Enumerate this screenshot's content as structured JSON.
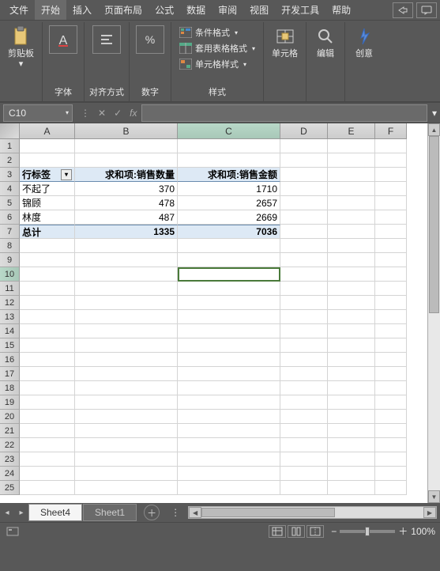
{
  "menu": {
    "items": [
      "文件",
      "开始",
      "插入",
      "页面布局",
      "公式",
      "数据",
      "审阅",
      "视图",
      "开发工具",
      "帮助"
    ],
    "active": 1
  },
  "ribbon": {
    "clipboard": {
      "label": "剪贴板",
      "dd": "▾"
    },
    "font": {
      "label": "字体"
    },
    "align": {
      "label": "对齐方式"
    },
    "number": {
      "label": "数字"
    },
    "styles": {
      "label": "样式",
      "cond": "条件格式",
      "cond_dd": "▾",
      "tbl": "套用表格格式",
      "tbl_dd": "▾",
      "cell": "单元格样式",
      "cell_dd": "▾"
    },
    "cells": {
      "label": "单元格"
    },
    "editing": {
      "label": "编辑"
    },
    "ideas": {
      "label": "创意"
    }
  },
  "namebox": {
    "value": "C10",
    "dd": "▾",
    "fx": "fx",
    "dots": "⋮"
  },
  "grid": {
    "cols": [
      {
        "name": "A",
        "w": 70
      },
      {
        "name": "B",
        "w": 130
      },
      {
        "name": "C",
        "w": 130,
        "sel": true
      },
      {
        "name": "D",
        "w": 60
      },
      {
        "name": "E",
        "w": 60
      },
      {
        "name": "F",
        "w": 40
      }
    ],
    "rowcount": 25,
    "selrow": 10,
    "selcell": {
      "r": 10,
      "c": 3
    },
    "hdr_row": 3,
    "hdr": [
      "行标签",
      "求和项:销售数量",
      "求和项:销售金额"
    ],
    "data": [
      {
        "r": 4,
        "a": "不起了",
        "b": "370",
        "c": "1710"
      },
      {
        "r": 5,
        "a": "锦顾",
        "b": "478",
        "c": "2657"
      },
      {
        "r": 6,
        "a": "林度",
        "b": "487",
        "c": "2669"
      }
    ],
    "total": {
      "r": 7,
      "a": "总计",
      "b": "1335",
      "c": "7036"
    }
  },
  "tabs": {
    "items": [
      "Sheet4",
      "Sheet1"
    ],
    "active": 0,
    "add": "＋",
    "dots": "⋮"
  },
  "status": {
    "zoom": "100%",
    "minus": "−",
    "plus": "＋"
  },
  "chart_data": {
    "type": "table",
    "title": "数据透视表",
    "columns": [
      "行标签",
      "求和项:销售数量",
      "求和项:销售金额"
    ],
    "rows": [
      [
        "不起了",
        370,
        1710
      ],
      [
        "锦顾",
        478,
        2657
      ],
      [
        "林度",
        487,
        2669
      ]
    ],
    "totals": [
      "总计",
      1335,
      7036
    ]
  }
}
